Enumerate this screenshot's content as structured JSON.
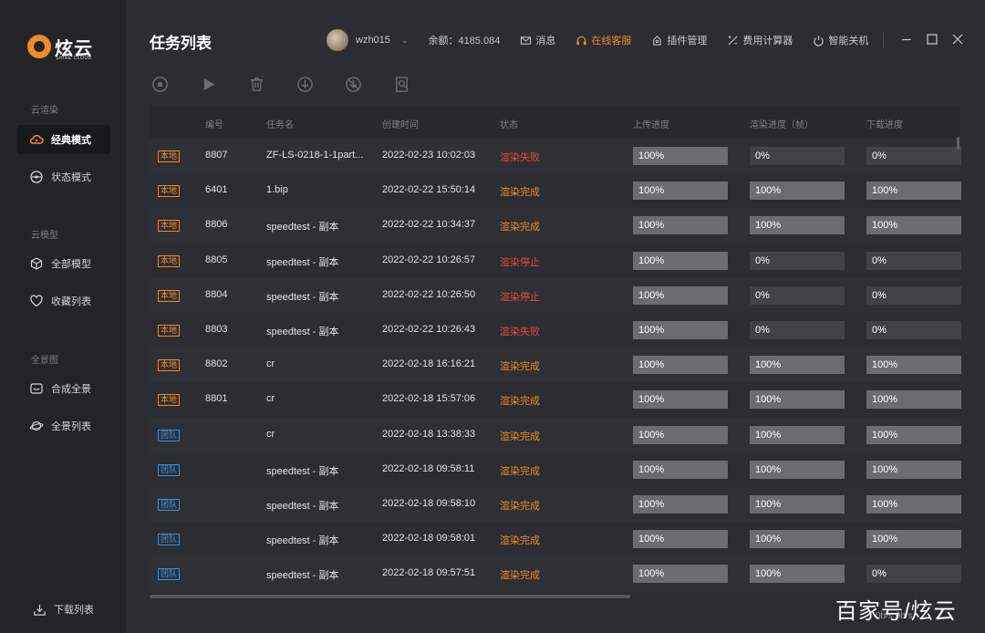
{
  "app": {
    "brand": "炫云",
    "brand_sub": "SHINE CLOUD",
    "accent_color": "#f08a2a"
  },
  "sidebar": {
    "sections": [
      {
        "title": "云渲染",
        "items": [
          {
            "label": "经典模式",
            "icon": "cloud-icon",
            "active": true
          },
          {
            "label": "状态模式",
            "icon": "gauge-icon",
            "active": false
          }
        ]
      },
      {
        "title": "云模型",
        "items": [
          {
            "label": "全部模型",
            "icon": "cube-icon",
            "active": false
          },
          {
            "label": "收藏列表",
            "icon": "heart-icon",
            "active": false
          }
        ]
      },
      {
        "title": "全景图",
        "items": [
          {
            "label": "合成全景",
            "icon": "panorama-icon",
            "active": false
          },
          {
            "label": "全景列表",
            "icon": "planet-icon",
            "active": false
          }
        ]
      }
    ],
    "download_list": "下载列表"
  },
  "header": {
    "title": "任务列表",
    "username": "wzh015",
    "balance": "余额：4185.084",
    "messages": "消息",
    "online_service": "在线客服",
    "plugin_manage": "插件管理",
    "cost_calculator": "费用计算器",
    "smart_shutdown": "智能关机"
  },
  "toolbar": {
    "icons": [
      "stop-icon",
      "play-icon",
      "trash-icon",
      "download-icon",
      "download-off-icon",
      "search-file-icon"
    ]
  },
  "table": {
    "columns": [
      "编号",
      "任务名",
      "创建时间",
      "状态",
      "上传进度",
      "渲染进度（帧）",
      "下载进度"
    ],
    "rows": [
      {
        "tag": "本地",
        "tag_type": "local",
        "id": "8807",
        "name": "ZF-LS-0218-1-1part...",
        "created": "2022-02-23 10:02:03",
        "status": "渲染失败",
        "status_type": "fail",
        "upload": "100%",
        "upload_pct": 100,
        "render": "0%",
        "render_pct": 0,
        "download": "0%",
        "download_pct": 0
      },
      {
        "tag": "本地",
        "tag_type": "local",
        "id": "6401",
        "name": "1.bip",
        "created": "2022-02-22 15:50:14",
        "status": "渲染完成",
        "status_type": "done",
        "upload": "100%",
        "upload_pct": 100,
        "render": "100%",
        "render_pct": 100,
        "download": "100%",
        "download_pct": 100
      },
      {
        "tag": "本地",
        "tag_type": "local",
        "id": "8806",
        "name": "speedtest - 副本",
        "created": "2022-02-22 10:34:37",
        "status": "渲染完成",
        "status_type": "done",
        "upload": "100%",
        "upload_pct": 100,
        "render": "100%",
        "render_pct": 100,
        "download": "100%",
        "download_pct": 100
      },
      {
        "tag": "本地",
        "tag_type": "local",
        "id": "8805",
        "name": "speedtest - 副本",
        "created": "2022-02-22 10:26:57",
        "status": "渲染停止",
        "status_type": "stop",
        "upload": "100%",
        "upload_pct": 100,
        "render": "0%",
        "render_pct": 0,
        "download": "0%",
        "download_pct": 0
      },
      {
        "tag": "本地",
        "tag_type": "local",
        "id": "8804",
        "name": "speedtest - 副本",
        "created": "2022-02-22 10:26:50",
        "status": "渲染停止",
        "status_type": "stop",
        "upload": "100%",
        "upload_pct": 100,
        "render": "0%",
        "render_pct": 0,
        "download": "0%",
        "download_pct": 0
      },
      {
        "tag": "本地",
        "tag_type": "local",
        "id": "8803",
        "name": "speedtest - 副本",
        "created": "2022-02-22 10:26:43",
        "status": "渲染失败",
        "status_type": "fail",
        "upload": "100%",
        "upload_pct": 100,
        "render": "0%",
        "render_pct": 0,
        "download": "0%",
        "download_pct": 0
      },
      {
        "tag": "本地",
        "tag_type": "local",
        "id": "8802",
        "name": "cr",
        "created": "2022-02-18 16:16:21",
        "status": "渲染完成",
        "status_type": "done",
        "upload": "100%",
        "upload_pct": 100,
        "render": "100%",
        "render_pct": 100,
        "download": "100%",
        "download_pct": 100
      },
      {
        "tag": "本地",
        "tag_type": "local",
        "id": "8801",
        "name": "cr",
        "created": "2022-02-18 15:57:06",
        "status": "渲染完成",
        "status_type": "done",
        "upload": "100%",
        "upload_pct": 100,
        "render": "100%",
        "render_pct": 100,
        "download": "100%",
        "download_pct": 100
      },
      {
        "tag": "团队",
        "tag_type": "team",
        "id": "",
        "name": "cr",
        "created": "2022-02-18 13:38:33",
        "status": "渲染完成",
        "status_type": "done",
        "upload": "100%",
        "upload_pct": 100,
        "render": "100%",
        "render_pct": 100,
        "download": "100%",
        "download_pct": 100
      },
      {
        "tag": "团队",
        "tag_type": "team",
        "id": "",
        "name": "speedtest - 副本",
        "created": "2022-02-18 09:58:11",
        "status": "渲染完成",
        "status_type": "done",
        "upload": "100%",
        "upload_pct": 100,
        "render": "100%",
        "render_pct": 100,
        "download": "100%",
        "download_pct": 100
      },
      {
        "tag": "团队",
        "tag_type": "team",
        "id": "",
        "name": "speedtest - 副本",
        "created": "2022-02-18 09:58:10",
        "status": "渲染完成",
        "status_type": "done",
        "upload": "100%",
        "upload_pct": 100,
        "render": "100%",
        "render_pct": 100,
        "download": "100%",
        "download_pct": 100
      },
      {
        "tag": "团队",
        "tag_type": "team",
        "id": "",
        "name": "speedtest - 副本",
        "created": "2022-02-18 09:58:01",
        "status": "渲染完成",
        "status_type": "done",
        "upload": "100%",
        "upload_pct": 100,
        "render": "100%",
        "render_pct": 100,
        "download": "100%",
        "download_pct": 100
      },
      {
        "tag": "团队",
        "tag_type": "team",
        "id": "",
        "name": "speedtest - 副本",
        "created": "2022-02-18 09:57:51",
        "status": "渲染完成",
        "status_type": "done",
        "upload": "100%",
        "upload_pct": 100,
        "render": "100%",
        "render_pct": 100,
        "download": "0%",
        "download_pct": 0
      }
    ]
  },
  "footer": {
    "speed": "0b/s  0b/s",
    "watermark": "百家号/炫云"
  }
}
